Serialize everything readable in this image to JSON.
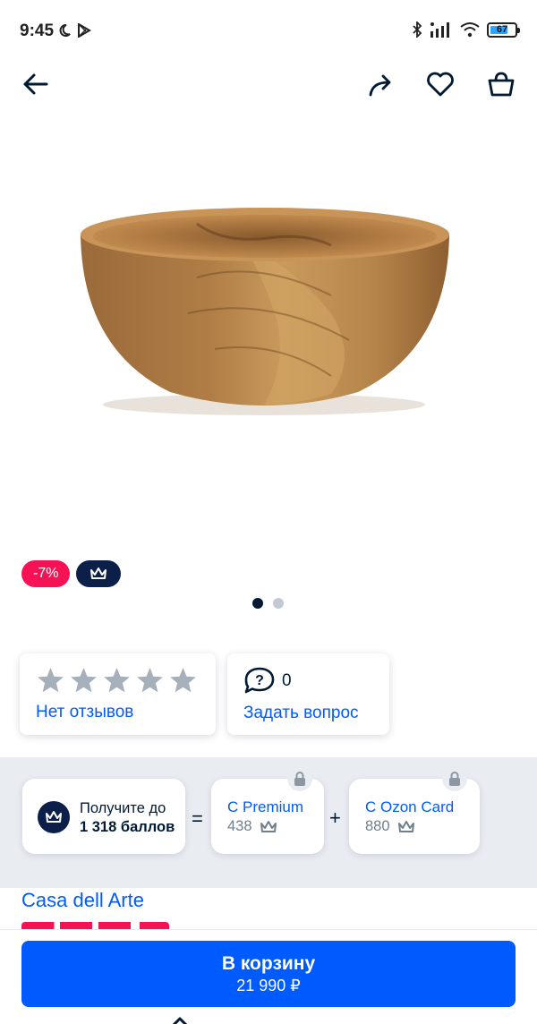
{
  "status_bar": {
    "time": "9:45",
    "battery": "67",
    "icons": [
      "moon-icon",
      "play-store-icon",
      "bluetooth-icon",
      "signal-icon",
      "wifi-icon",
      "battery-icon"
    ]
  },
  "nav": {
    "icons": [
      "back-arrow-icon",
      "share-icon",
      "heart-icon",
      "cart-icon"
    ]
  },
  "product": {
    "image_subject": "wooden bowl",
    "discount_badge": "-7%",
    "premium_badge_icon": "crown-icon",
    "gallery_dots": 2,
    "gallery_active": 0
  },
  "reviews": {
    "stars_filled": 0,
    "stars_total": 5,
    "label": "Нет отзывов"
  },
  "questions": {
    "count": "0",
    "label": "Задать вопрос"
  },
  "points": {
    "main_line1": "Получите до",
    "main_line2": "1 318 баллов",
    "equals": "=",
    "plus": "+",
    "premium": {
      "title": "С Premium",
      "value": "438"
    },
    "ozon_card": {
      "title": "С Ozon Card",
      "value": "880"
    }
  },
  "brand": "Casa dell Arte",
  "cart_button": {
    "label": "В корзину",
    "price": "21 990 ₽"
  },
  "colors": {
    "accent": "#005bff",
    "discount": "#f91155",
    "premium": "#0b1f49",
    "band": "#e9edf2"
  }
}
